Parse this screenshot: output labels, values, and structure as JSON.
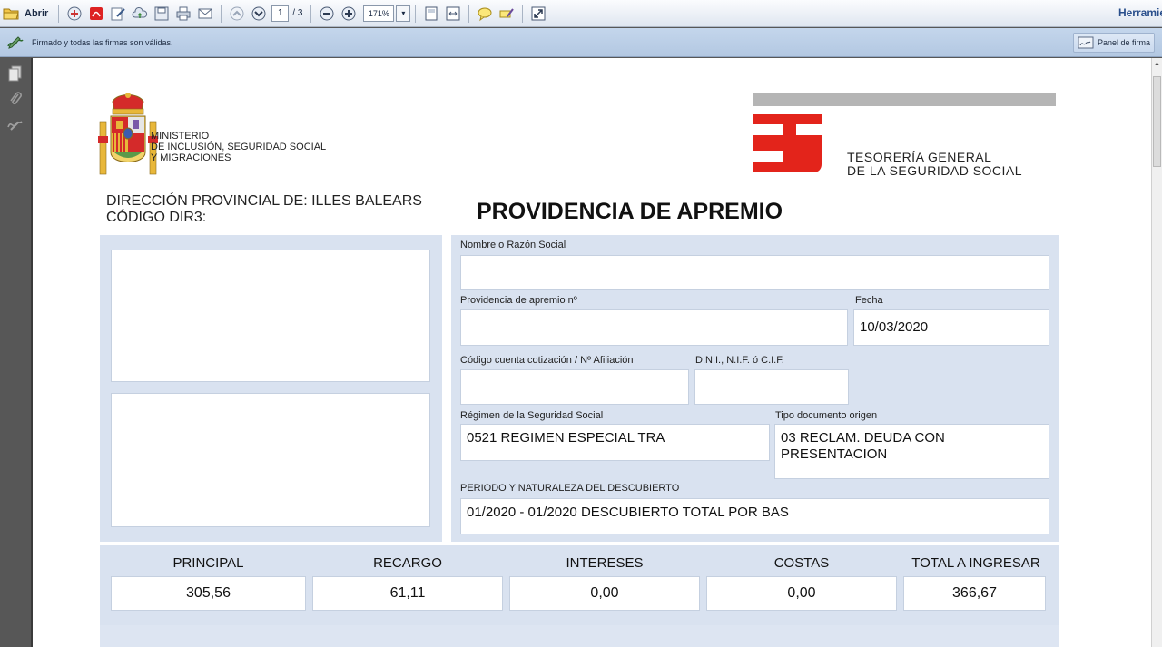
{
  "toolbar": {
    "open_label": "Abrir",
    "current_page": "1",
    "total_pages": "/ 3",
    "zoom": "171%",
    "tools_label": "Herramie"
  },
  "signature_bar": {
    "status_text": "Firmado y todas las firmas son válidas.",
    "panel_button": "Panel de firma"
  },
  "document": {
    "ministry_lines": [
      "MINISTERIO",
      "DE INCLUSIÓN, SEGURIDAD SOCIAL",
      "Y MIGRACIONES"
    ],
    "tgss_lines": [
      "TESORERÍA GENERAL",
      "DE LA SEGURIDAD SOCIAL"
    ],
    "direccion": "DIRECCIÓN PROVINCIAL DE: ILLES BALEARS",
    "codigo_dir3": "CÓDIGO DIR3:",
    "title": "PROVIDENCIA DE APREMIO",
    "fields": {
      "nombre_label": "Nombre o Razón Social",
      "nombre_value": "",
      "providencia_label": "Providencia de apremio nº",
      "providencia_value": "",
      "fecha_label": "Fecha",
      "fecha_value": "10/03/2020",
      "ccc_label": "Código cuenta  cotización / Nº Afiliación",
      "ccc_value": "",
      "dni_label": "D.N.I., N.I.F. ó C.I.F.",
      "dni_value": "",
      "regimen_label": "Régimen de la Seguridad Social",
      "regimen_value": "0521 REGIMEN ESPECIAL TRA",
      "tipo_doc_label": "Tipo documento origen",
      "tipo_doc_value": "03 RECLAM. DEUDA CON PRESENTACION",
      "periodo_label": "PERIODO Y NATURALEZA DEL DESCUBIERTO",
      "periodo_value": "01/2020 - 01/2020 DESCUBIERTO TOTAL POR BAS"
    },
    "amounts": [
      {
        "label": "PRINCIPAL",
        "value": "305,56"
      },
      {
        "label": "RECARGO",
        "value": "61,11"
      },
      {
        "label": "INTERESES",
        "value": "0,00"
      },
      {
        "label": "COSTAS",
        "value": "0,00"
      },
      {
        "label": "TOTAL A INGRESAR",
        "value": "366,67"
      }
    ]
  },
  "colors": {
    "form_panel": "#d9e2f0",
    "tgss_red": "#e3241b",
    "viewer_bg": "#575757"
  }
}
